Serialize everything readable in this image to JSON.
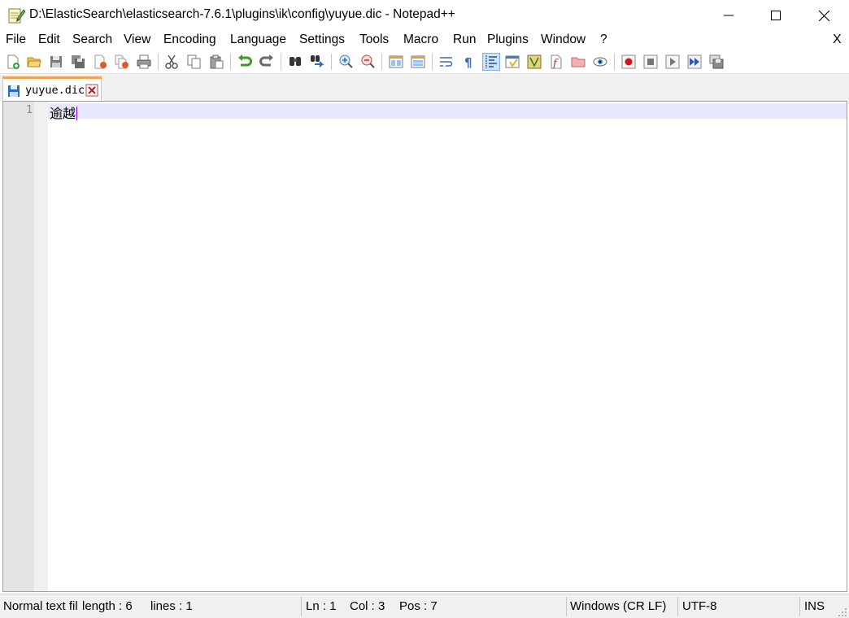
{
  "window": {
    "title": "D:\\ElasticSearch\\elasticsearch-7.6.1\\plugins\\ik\\config\\yuyue.dic - Notepad++",
    "minimize_icon": "minimize-icon",
    "maximize_icon": "maximize-icon",
    "close_icon": "close-icon"
  },
  "menu": {
    "items": [
      "File",
      "Edit",
      "Search",
      "View",
      "Encoding",
      "Language",
      "Settings",
      "Tools",
      "Macro",
      "Run",
      "Plugins",
      "Window",
      "?"
    ],
    "close_label": "X"
  },
  "toolbar": {
    "icons": [
      "new-file-icon",
      "open-file-icon",
      "save-icon",
      "save-all-icon",
      "close-icon",
      "close-all-icon",
      "print-icon",
      "cut-icon",
      "copy-icon",
      "paste-icon",
      "undo-icon",
      "redo-icon",
      "find-icon",
      "replace-icon",
      "zoom-in-icon",
      "zoom-out-icon",
      "sync-vertical-icon",
      "sync-horizontal-icon",
      "word-wrap-icon",
      "show-all-chars-icon",
      "indent-guide-icon",
      "user-language-icon",
      "document-map-icon",
      "function-list-icon",
      "folder-workspace-icon",
      "monitoring-icon",
      "record-macro-icon",
      "stop-record-icon",
      "play-macro-icon",
      "run-macro-multiple-icon",
      "save-macro-icon"
    ]
  },
  "tab": {
    "label": "yuyue.dic",
    "accent_color": "#f5a24a"
  },
  "editor": {
    "line_number": "1",
    "line_text": "逾越",
    "current_line_color": "#e8e8ff",
    "caret_color": "#7f00ff"
  },
  "status": {
    "lang": "Normal text file",
    "length": "length : 6",
    "lines": "lines : 1",
    "ln": "Ln : 1",
    "col": "Col : 3",
    "pos": "Pos : 7",
    "eol": "Windows (CR LF)",
    "encoding": "UTF-8",
    "mode": "INS"
  }
}
